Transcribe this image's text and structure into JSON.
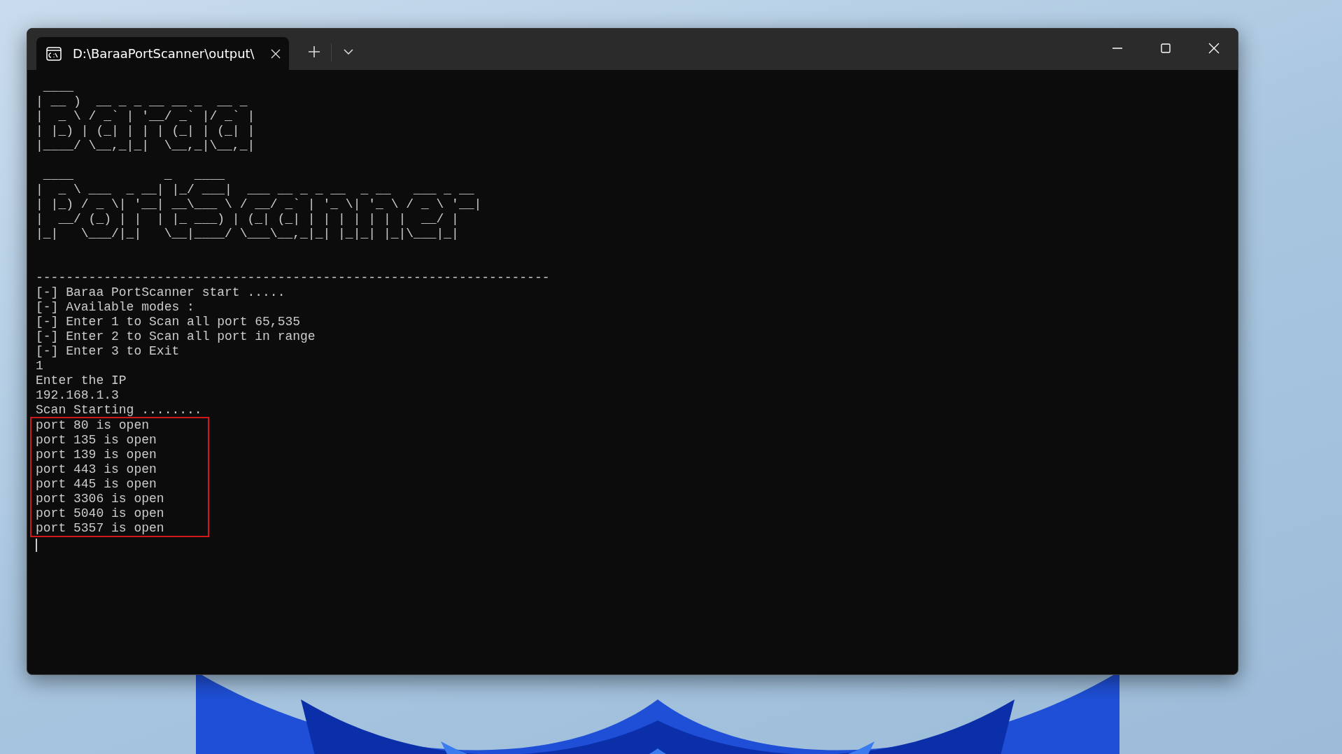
{
  "window": {
    "tabs": [
      {
        "label": "D:\\BaraaPortScanner\\output\\",
        "selected": true
      }
    ]
  },
  "terminal": {
    "banners": [
      {
        "lines": [
          " ____",
          "| __ )  __ _ _ __ __ _  __ _",
          "|  _ \\ / _` | '__/ _` |/ _` |",
          "| |_) | (_| | | | (_| | (_| |",
          "|____/ \\__,_|_|  \\__,_|\\__,_|"
        ]
      },
      {
        "lines": [
          " ____            _   ____",
          "|  _ \\ ___  _ __| |_/ ___|  ___ __ _ _ __  _ __   ___ _ __",
          "| |_) / _ \\| '__| __\\___ \\ / __/ _` | '_ \\| '_ \\ / _ \\ '__|",
          "|  __/ (_) | |  | |_ ___) | (_| (_| | | | | | | |  __/ |",
          "|_|   \\___/|_|   \\__|____/ \\___\\__,_|_| |_|_| |_|\\___|_|"
        ]
      }
    ],
    "divider": "--------------------------------------------------------------------",
    "lines": [
      "[-] Baraa PortScanner start .....",
      "[-] Available modes :",
      "[-] Enter 1 to Scan all port 65,535",
      "[-] Enter 2 to Scan all port in range",
      "[-] Enter 3 to Exit",
      "1",
      "Enter the IP",
      "192.168.1.3",
      "Scan Starting ........"
    ],
    "highlighted_lines": [
      "port 80 is open",
      "port 135 is open",
      "port 139 is open",
      "port 443 is open",
      "port 445 is open",
      "port 3306 is open",
      "port 5040 is open",
      "port 5357 is open"
    ]
  }
}
